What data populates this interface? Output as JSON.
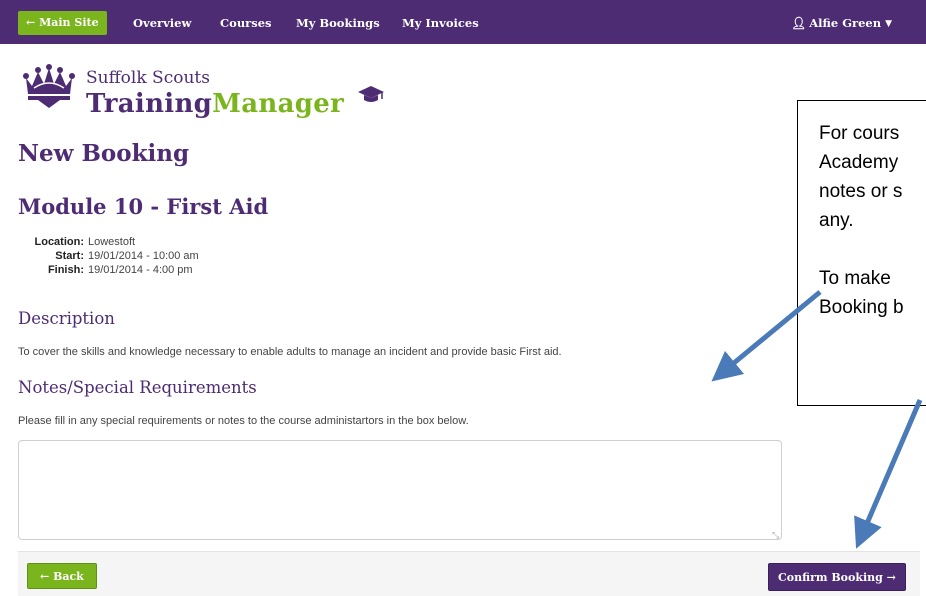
{
  "nav": {
    "main_site": "Main Site",
    "items": [
      "Overview",
      "Courses",
      "My Bookings",
      "My Invoices"
    ],
    "user": "Alfie Green"
  },
  "logo": {
    "line1": "Suffolk Scouts",
    "part1": "Training",
    "part2": "Manager"
  },
  "page": {
    "title": "New Booking",
    "course_title": "Module 10 - First Aid"
  },
  "details": [
    {
      "label": "Location:",
      "value": "Lowestoft"
    },
    {
      "label": "Start:",
      "value": "19/01/2014 - 10:00 am"
    },
    {
      "label": "Finish:",
      "value": "19/01/2014 - 4:00 pm"
    }
  ],
  "description": {
    "heading": "Description",
    "text": "To cover the skills and knowledge necessary to enable adults to manage an incident and provide basic First aid."
  },
  "notes": {
    "heading": "Notes/Special Requirements",
    "text": "Please fill in any special requirements or notes to the course administartors in the box below.",
    "value": ""
  },
  "buttons": {
    "back": "Back",
    "confirm": "Confirm Booking"
  },
  "callout": {
    "lines": [
      "For cours",
      "Academy",
      "notes or s",
      "any.",
      "",
      "To make",
      "Booking b"
    ]
  },
  "colors": {
    "brand_purple": "#4d2c73",
    "brand_green": "#7ab51d",
    "annotation_arrow": "#4a7ab8"
  }
}
